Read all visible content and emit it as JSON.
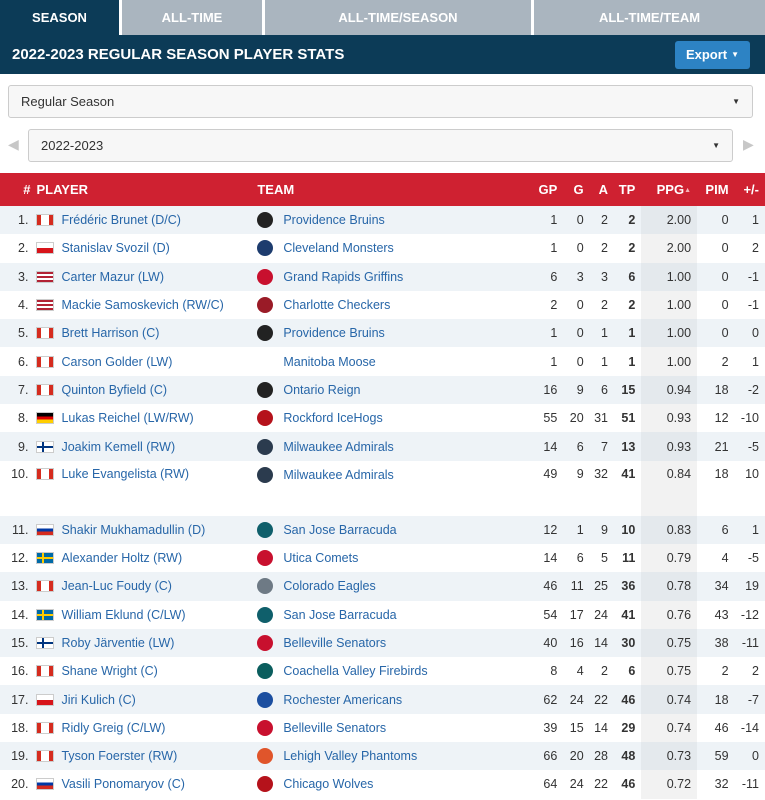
{
  "tabs": [
    "SEASON",
    "ALL-TIME",
    "ALL-TIME/SEASON",
    "ALL-TIME/TEAM"
  ],
  "header": {
    "title": "2022-2023 REGULAR SEASON PLAYER STATS",
    "export_label": "Export"
  },
  "filters": {
    "season_type": "Regular Season",
    "season": "2022-2023"
  },
  "columns": {
    "rank": "#",
    "player": "PLAYER",
    "team": "TEAM",
    "gp": "GP",
    "g": "G",
    "a": "A",
    "tp": "TP",
    "ppg": "PPG",
    "pim": "PIM",
    "pm": "+/-"
  },
  "colors": {
    "tab_active": "#0c3b57",
    "tab_inactive": "#aab5bf",
    "header_bg": "#0c3b57",
    "table_header": "#cf2131",
    "export_btn": "#2d83c4",
    "link": "#2766a8"
  },
  "rows": [
    {
      "rank": "1.",
      "flag": "canada-flag",
      "player": "Frédéric Brunet (D/C)",
      "team_logo": "bruins-logo",
      "team": "Providence Bruins",
      "gp": "1",
      "g": "0",
      "a": "2",
      "tp": "2",
      "ppg": "2.00",
      "pim": "0",
      "pm": "1"
    },
    {
      "rank": "2.",
      "flag": "czech-flag",
      "player": "Stanislav Svozil (D)",
      "team_logo": "monsters-logo",
      "team": "Cleveland Monsters",
      "gp": "1",
      "g": "0",
      "a": "2",
      "tp": "2",
      "ppg": "2.00",
      "pim": "0",
      "pm": "2"
    },
    {
      "rank": "3.",
      "flag": "usa-flag",
      "player": "Carter Mazur (LW)",
      "team_logo": "griffins-logo",
      "team": "Grand Rapids Griffins",
      "gp": "6",
      "g": "3",
      "a": "3",
      "tp": "6",
      "ppg": "1.00",
      "pim": "0",
      "pm": "-1"
    },
    {
      "rank": "4.",
      "flag": "usa-flag",
      "player": "Mackie Samoskevich (RW/C)",
      "team_logo": "checkers-logo",
      "team": "Charlotte Checkers",
      "gp": "2",
      "g": "0",
      "a": "2",
      "tp": "2",
      "ppg": "1.00",
      "pim": "0",
      "pm": "-1"
    },
    {
      "rank": "5.",
      "flag": "canada-flag",
      "player": "Brett Harrison (C)",
      "team_logo": "bruins-logo",
      "team": "Providence Bruins",
      "gp": "1",
      "g": "0",
      "a": "1",
      "tp": "1",
      "ppg": "1.00",
      "pim": "0",
      "pm": "0"
    },
    {
      "rank": "6.",
      "flag": "canada-flag",
      "player": "Carson Golder (LW)",
      "team_logo": "",
      "team": "Manitoba Moose",
      "gp": "1",
      "g": "0",
      "a": "1",
      "tp": "1",
      "ppg": "1.00",
      "pim": "2",
      "pm": "1"
    },
    {
      "rank": "7.",
      "flag": "canada-flag",
      "player": "Quinton Byfield (C)",
      "team_logo": "reign-logo",
      "team": "Ontario Reign",
      "gp": "16",
      "g": "9",
      "a": "6",
      "tp": "15",
      "ppg": "0.94",
      "pim": "18",
      "pm": "-2"
    },
    {
      "rank": "8.",
      "flag": "germany-flag",
      "player": "Lukas Reichel (LW/RW)",
      "team_logo": "icehogs-logo",
      "team": "Rockford IceHogs",
      "gp": "55",
      "g": "20",
      "a": "31",
      "tp": "51",
      "ppg": "0.93",
      "pim": "12",
      "pm": "-10"
    },
    {
      "rank": "9.",
      "flag": "finland-flag",
      "player": "Joakim Kemell (RW)",
      "team_logo": "admirals-logo",
      "team": "Milwaukee Admirals",
      "gp": "14",
      "g": "6",
      "a": "7",
      "tp": "13",
      "ppg": "0.93",
      "pim": "21",
      "pm": "-5"
    },
    {
      "rank": "10.",
      "flag": "canada-flag",
      "player": "Luke Evangelista (RW)",
      "team_logo": "admirals-logo",
      "team": "Milwaukee Admirals",
      "gp": "49",
      "g": "9",
      "a": "32",
      "tp": "41",
      "ppg": "0.84",
      "pim": "18",
      "pm": "10"
    },
    {
      "rank": "11.",
      "flag": "russia-flag",
      "player": "Shakir Mukhamadullin (D)",
      "team_logo": "barracuda-logo",
      "team": "San Jose Barracuda",
      "gp": "12",
      "g": "1",
      "a": "9",
      "tp": "10",
      "ppg": "0.83",
      "pim": "6",
      "pm": "1"
    },
    {
      "rank": "12.",
      "flag": "sweden-flag",
      "player": "Alexander Holtz (RW)",
      "team_logo": "comets-logo",
      "team": "Utica Comets",
      "gp": "14",
      "g": "6",
      "a": "5",
      "tp": "11",
      "ppg": "0.79",
      "pim": "4",
      "pm": "-5"
    },
    {
      "rank": "13.",
      "flag": "canada-flag",
      "player": "Jean-Luc Foudy (C)",
      "team_logo": "eagles-logo",
      "team": "Colorado Eagles",
      "gp": "46",
      "g": "11",
      "a": "25",
      "tp": "36",
      "ppg": "0.78",
      "pim": "34",
      "pm": "19"
    },
    {
      "rank": "14.",
      "flag": "sweden-flag",
      "player": "William Eklund (C/LW)",
      "team_logo": "barracuda-logo",
      "team": "San Jose Barracuda",
      "gp": "54",
      "g": "17",
      "a": "24",
      "tp": "41",
      "ppg": "0.76",
      "pim": "43",
      "pm": "-12"
    },
    {
      "rank": "15.",
      "flag": "finland-flag",
      "player": "Roby Järventie (LW)",
      "team_logo": "senators-logo",
      "team": "Belleville Senators",
      "gp": "40",
      "g": "16",
      "a": "14",
      "tp": "30",
      "ppg": "0.75",
      "pim": "38",
      "pm": "-11"
    },
    {
      "rank": "16.",
      "flag": "canada-flag",
      "player": "Shane Wright (C)",
      "team_logo": "firebirds-logo",
      "team": "Coachella Valley Firebirds",
      "gp": "8",
      "g": "4",
      "a": "2",
      "tp": "6",
      "ppg": "0.75",
      "pim": "2",
      "pm": "2"
    },
    {
      "rank": "17.",
      "flag": "czech-flag",
      "player": "Jiri Kulich (C)",
      "team_logo": "americans-logo",
      "team": "Rochester Americans",
      "gp": "62",
      "g": "24",
      "a": "22",
      "tp": "46",
      "ppg": "0.74",
      "pim": "18",
      "pm": "-7"
    },
    {
      "rank": "18.",
      "flag": "canada-flag",
      "player": "Ridly Greig (C/LW)",
      "team_logo": "senators-logo",
      "team": "Belleville Senators",
      "gp": "39",
      "g": "15",
      "a": "14",
      "tp": "29",
      "ppg": "0.74",
      "pim": "46",
      "pm": "-14"
    },
    {
      "rank": "19.",
      "flag": "canada-flag",
      "player": "Tyson Foerster (RW)",
      "team_logo": "phantoms-logo",
      "team": "Lehigh Valley Phantoms",
      "gp": "66",
      "g": "20",
      "a": "28",
      "tp": "48",
      "ppg": "0.73",
      "pim": "59",
      "pm": "0"
    },
    {
      "rank": "20.",
      "flag": "russia-flag",
      "player": "Vasili Ponomaryov (C)",
      "team_logo": "wolves-logo",
      "team": "Chicago Wolves",
      "gp": "64",
      "g": "24",
      "a": "22",
      "tp": "46",
      "ppg": "0.72",
      "pim": "32",
      "pm": "-11"
    }
  ]
}
